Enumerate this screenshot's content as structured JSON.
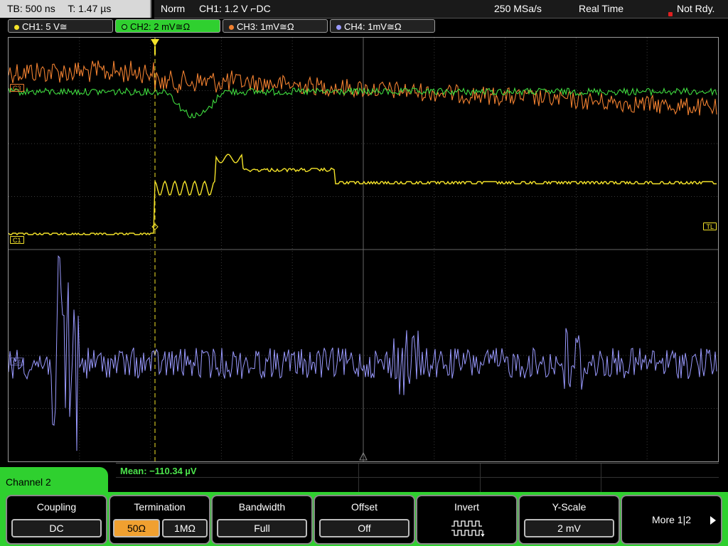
{
  "status_bar": {
    "timebase": "TB: 500 ns",
    "time": "T: 1.47 µs",
    "mode": "Norm",
    "trigger": "CH1: 1.2 V ⌐DC",
    "sample_rate": "250 MSa/s",
    "realtime": "Real Time",
    "state": "Not Rdy."
  },
  "channel_tabs": [
    {
      "label": "CH1: 5 V≅",
      "color": "#f5e42a",
      "active": false
    },
    {
      "label": "CH2: 2 mV≅Ω",
      "color": "#3fdc3f",
      "active": true
    },
    {
      "label": "CH3: 1mV≅Ω",
      "color": "#f08030",
      "active": false
    },
    {
      "label": "CH4: 1mV≅Ω",
      "color": "#9a9aff",
      "active": false
    }
  ],
  "markers": {
    "c3": "C3",
    "c1": "C1",
    "c2": "C2",
    "c4": "C4",
    "trigger_level": "TL"
  },
  "measurement": {
    "mean": "Mean: −110.34 µV"
  },
  "menu": {
    "channel_title": "Channel 2",
    "coupling_title": "Coupling",
    "coupling_value": "DC",
    "termination_title": "Termination",
    "termination_opt1": "50Ω",
    "termination_opt2": "1MΩ",
    "bandwidth_title": "Bandwidth",
    "bandwidth_value": "Full",
    "offset_title": "Offset",
    "offset_value": "Off",
    "invert_title": "Invert",
    "yscale_title": "Y-Scale",
    "yscale_value": "2 mV",
    "more_label": "More 1|2"
  },
  "colors": {
    "ch1": "#f5e42a",
    "ch2": "#3fdc3f",
    "ch3": "#f08030",
    "ch4": "#9a9aff",
    "menu_accent": "#2fd02f",
    "selected_option": "#f0a030"
  }
}
